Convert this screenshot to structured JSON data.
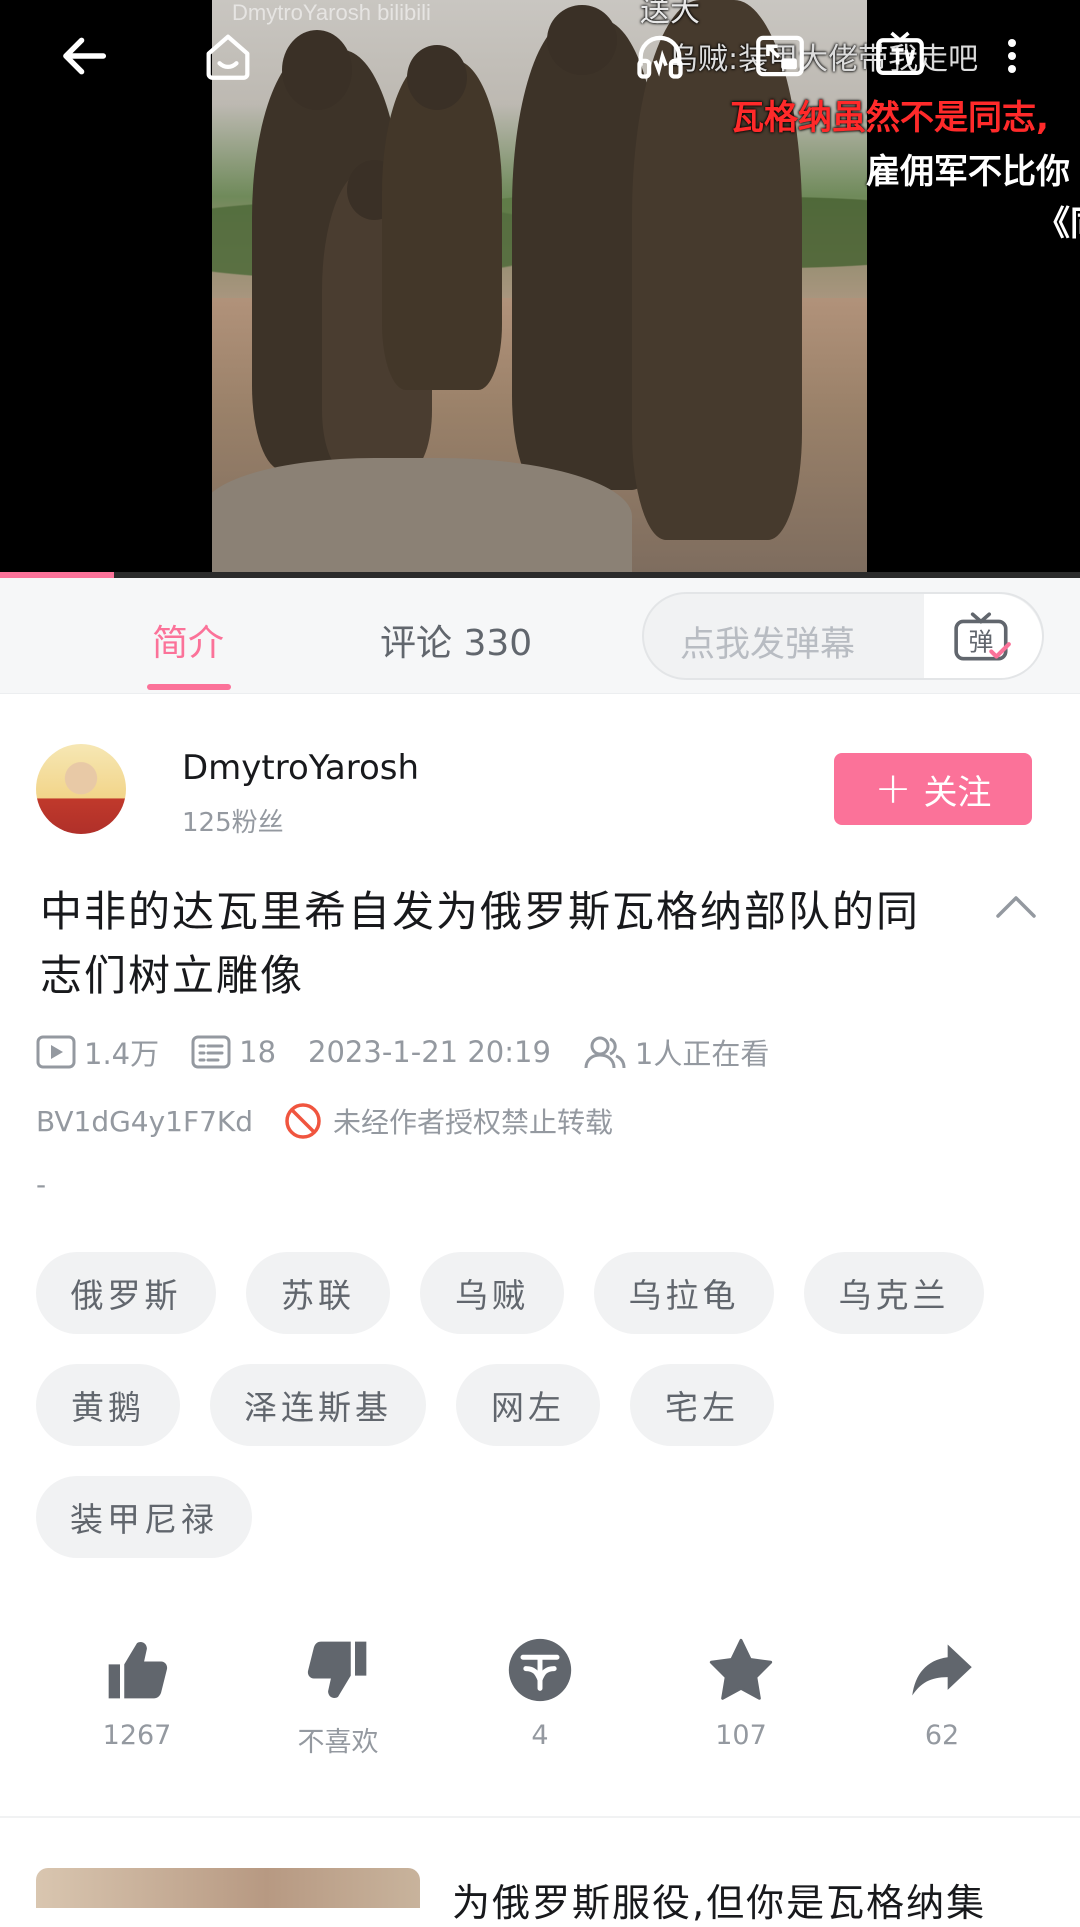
{
  "player": {
    "watermark": "DmytroYarosh bilibili",
    "progress_fraction": 0.106,
    "controls": [
      "back-arrow-icon",
      "home-icon",
      "headphones-icon",
      "pip-icon",
      "tv-cast-icon",
      "more-vert-icon"
    ],
    "danmaku": [
      {
        "text": "送大",
        "color": "#e8e8e8"
      },
      {
        "text": "乌贼:装甲大佬带我走吧",
        "color": "#dcdcdc"
      },
      {
        "text": "瓦格纳虽然不是同志,",
        "color": "#ff2a2a"
      },
      {
        "text": "雇佣军不比你",
        "color": "#ffffff"
      },
      {
        "text": "《同",
        "color": "#ffffff"
      }
    ]
  },
  "tabs": [
    {
      "label": "简介",
      "active": true
    },
    {
      "label": "评论 330",
      "active": false
    }
  ],
  "danmaku_input": {
    "placeholder": "点我发弹幕",
    "button_glyph": "弹"
  },
  "uploader": {
    "name": "DmytroYarosh",
    "fans": "125粉丝",
    "follow_label": "关注",
    "follow_icon": "+"
  },
  "video": {
    "title": "中非的达瓦里希自发为俄罗斯瓦格纳部队的同志们树立雕像",
    "views": "1.4万",
    "danmaku_count": "18",
    "date": "2023-1-21 20:19",
    "watching": "1人正在看",
    "bvid": "BV1dG4y1F7Kd",
    "repost_notice": "未经作者授权禁止转载",
    "description": "-"
  },
  "tags": [
    "俄罗斯",
    "苏联",
    "乌贼",
    "乌拉龟",
    "乌克兰",
    "黄鹅",
    "泽连斯基",
    "网左",
    "宅左",
    "装甲尼禄"
  ],
  "actions": [
    {
      "name": "like",
      "icon": "thumbs-up-icon",
      "count": "1267"
    },
    {
      "name": "dislike",
      "icon": "thumbs-down-icon",
      "count": "不喜欢"
    },
    {
      "name": "coin",
      "icon": "coin-icon",
      "count": "4"
    },
    {
      "name": "favorite",
      "icon": "star-icon",
      "count": "107"
    },
    {
      "name": "share",
      "icon": "share-icon",
      "count": "62"
    }
  ],
  "recommendation": {
    "title_visible": "为俄罗斯服役,但你是瓦格纳集"
  },
  "colors": {
    "accent": "#fb7299",
    "muted": "#9499a0",
    "tag_bg": "#f1f2f3",
    "icon": "#61666d"
  }
}
